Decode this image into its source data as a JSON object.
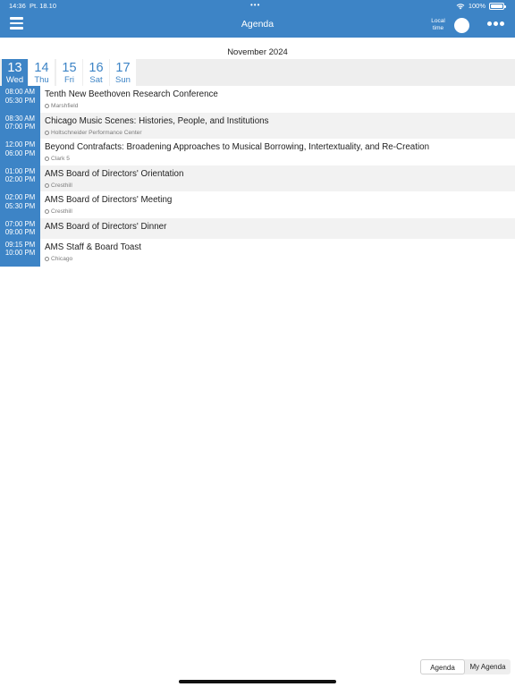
{
  "status_bar": {
    "time": "14:36",
    "date": "Pt. 18.10",
    "dots": "•••",
    "battery": "100%",
    "icons": [
      "wifi-icon",
      "battery-icon"
    ]
  },
  "header": {
    "title": "Agenda",
    "local_time_label": "Local time",
    "icons": [
      "menu-icon",
      "more-icon"
    ],
    "accent_color": "#3d84c6"
  },
  "month_label": "November 2024",
  "days": [
    {
      "num": "13",
      "dow": "Wed",
      "selected": true
    },
    {
      "num": "14",
      "dow": "Thu",
      "selected": false
    },
    {
      "num": "15",
      "dow": "Fri",
      "selected": false
    },
    {
      "num": "16",
      "dow": "Sat",
      "selected": false
    },
    {
      "num": "17",
      "dow": "Sun",
      "selected": false
    }
  ],
  "events": [
    {
      "start": "08:00 AM",
      "end": "05:30 PM",
      "title": "Tenth New Beethoven Research Conference",
      "location": "Marshfield"
    },
    {
      "start": "08:30 AM",
      "end": "07:00 PM",
      "title": "Chicago Music Scenes: Histories, People, and Institutions",
      "location": "Holtschneider Performance Center"
    },
    {
      "start": "12:00 PM",
      "end": "06:00 PM",
      "title": "Beyond Contrafacts: Broadening Approaches to Musical Borrowing, Intertextuality, and Re-Creation",
      "location": "Clark 5"
    },
    {
      "start": "01:00 PM",
      "end": "02:00 PM",
      "title": "AMS Board of Directors' Orientation",
      "location": "Cresthill"
    },
    {
      "start": "02:00 PM",
      "end": "05:30 PM",
      "title": "AMS Board of Directors' Meeting",
      "location": "Cresthill"
    },
    {
      "start": "07:00 PM",
      "end": "09:00 PM",
      "title": "AMS Board of Directors' Dinner",
      "location": ""
    },
    {
      "start": "09:15 PM",
      "end": "10:00 PM",
      "title": "AMS Staff & Board Toast",
      "location": "Chicago"
    }
  ],
  "bottom_tabs": {
    "agenda": "Agenda",
    "my_agenda": "My Agenda"
  }
}
